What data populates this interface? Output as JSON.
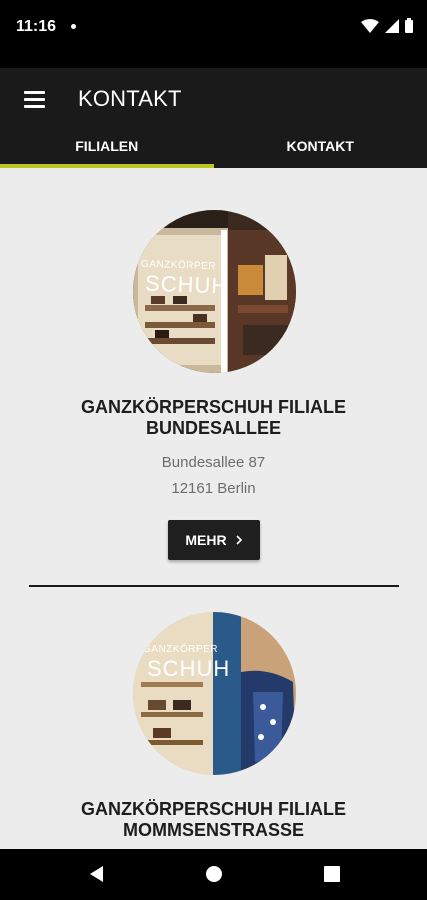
{
  "status_bar": {
    "time": "11:16"
  },
  "app_bar": {
    "title": "KONTAKT"
  },
  "tabs": [
    {
      "label": "FILIALEN",
      "active": true
    },
    {
      "label": "KONTAKT",
      "active": false
    }
  ],
  "branches": [
    {
      "name_line1": "GANZKÖRPERSCHUH FILIALE",
      "name_line2": "BUNDESALLEE",
      "street": "Bundesallee 87",
      "city": "12161 Berlin",
      "button_label": "MEHR",
      "photo_sign_top": "GANZKÖRPER",
      "photo_sign_bottom": "SCHUH"
    },
    {
      "name_line1": "GANZKÖRPERSCHUH FILIALE",
      "name_line2": "MOMMSENSTRASSE",
      "photo_sign_top": "GANZKÖRPER",
      "photo_sign_bottom": "SCHUH"
    }
  ],
  "colors": {
    "accent": "#b8c81e",
    "app_bar": "#1a1a1a",
    "background": "#ececec"
  }
}
